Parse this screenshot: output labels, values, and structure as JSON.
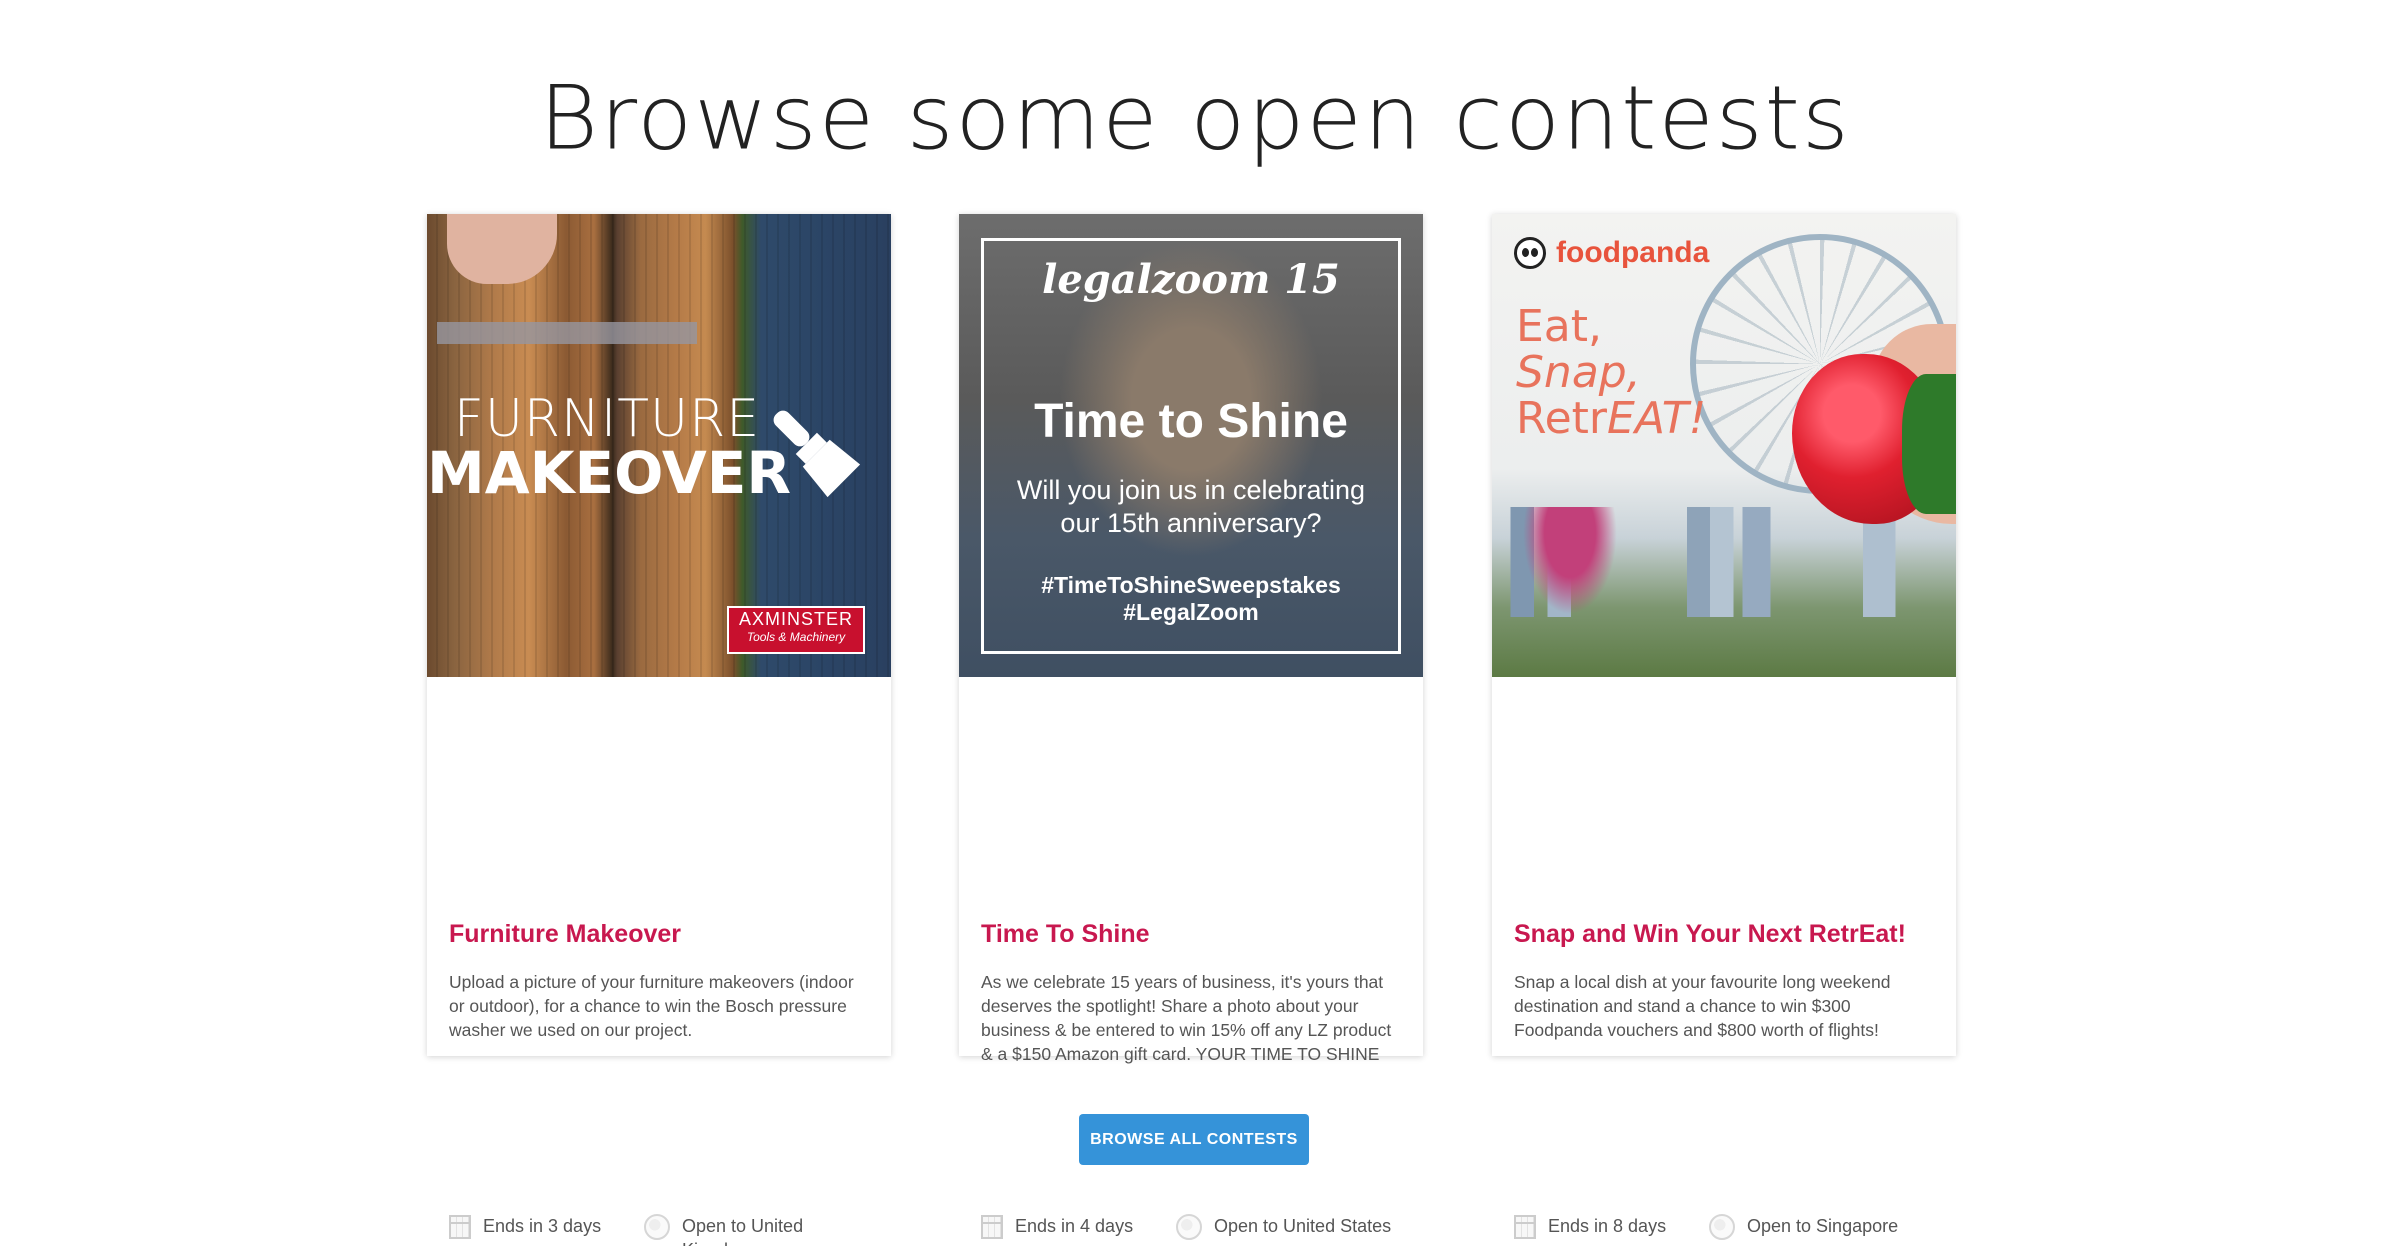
{
  "page": {
    "title": "Browse some open contests"
  },
  "contests": [
    {
      "title": "Furniture Makeover",
      "description": "Upload a picture of your furniture makeovers (indoor or outdoor), for a chance to win the Bosch pressure washer we used on our project.",
      "ends": "Ends in 3 days",
      "open_to": "Open to United Kingdom",
      "image": {
        "line1": "FURNITURE",
        "line2": "MAKEOVER",
        "logo_line1": "AXMINSTER",
        "logo_line2": "Tools & Machinery"
      }
    },
    {
      "title": "Time To Shine",
      "description": "As we celebrate 15 years of business, it's yours that deserves the spotlight! Share a photo about your business & be entered to win 15% off any LZ product & a $150 Amazon gift card. YOUR TIME TO SHINE",
      "ends": "Ends in 4 days",
      "open_to": "Open to United States",
      "image": {
        "brand": "legalzoom 15",
        "heading": "Time to Shine",
        "subheading": "Will you join us in celebrating our 15th anniversary?",
        "tag1": "#TimeToShineSweepstakes",
        "tag2": "#LegalZoom"
      }
    },
    {
      "title": "Snap and Win Your Next RetrEat!",
      "description": "Snap a local dish at your favourite long weekend destination and stand a chance to win $300 Foodpanda vouchers and $800 worth of flights!",
      "ends": "Ends in 8 days",
      "open_to": "Open to Singapore",
      "image": {
        "brand": "foodpanda",
        "slogan1": "Eat,",
        "slogan2": "Snap,",
        "slogan3a": "Retr",
        "slogan3b": "EAT!"
      }
    }
  ],
  "cta": {
    "label": "BROWSE ALL CONTESTS"
  },
  "icons": {
    "calendar": "calendar-icon",
    "globe": "globe-icon"
  },
  "colors": {
    "title_accent": "#c8184f",
    "button": "#3593d9"
  }
}
